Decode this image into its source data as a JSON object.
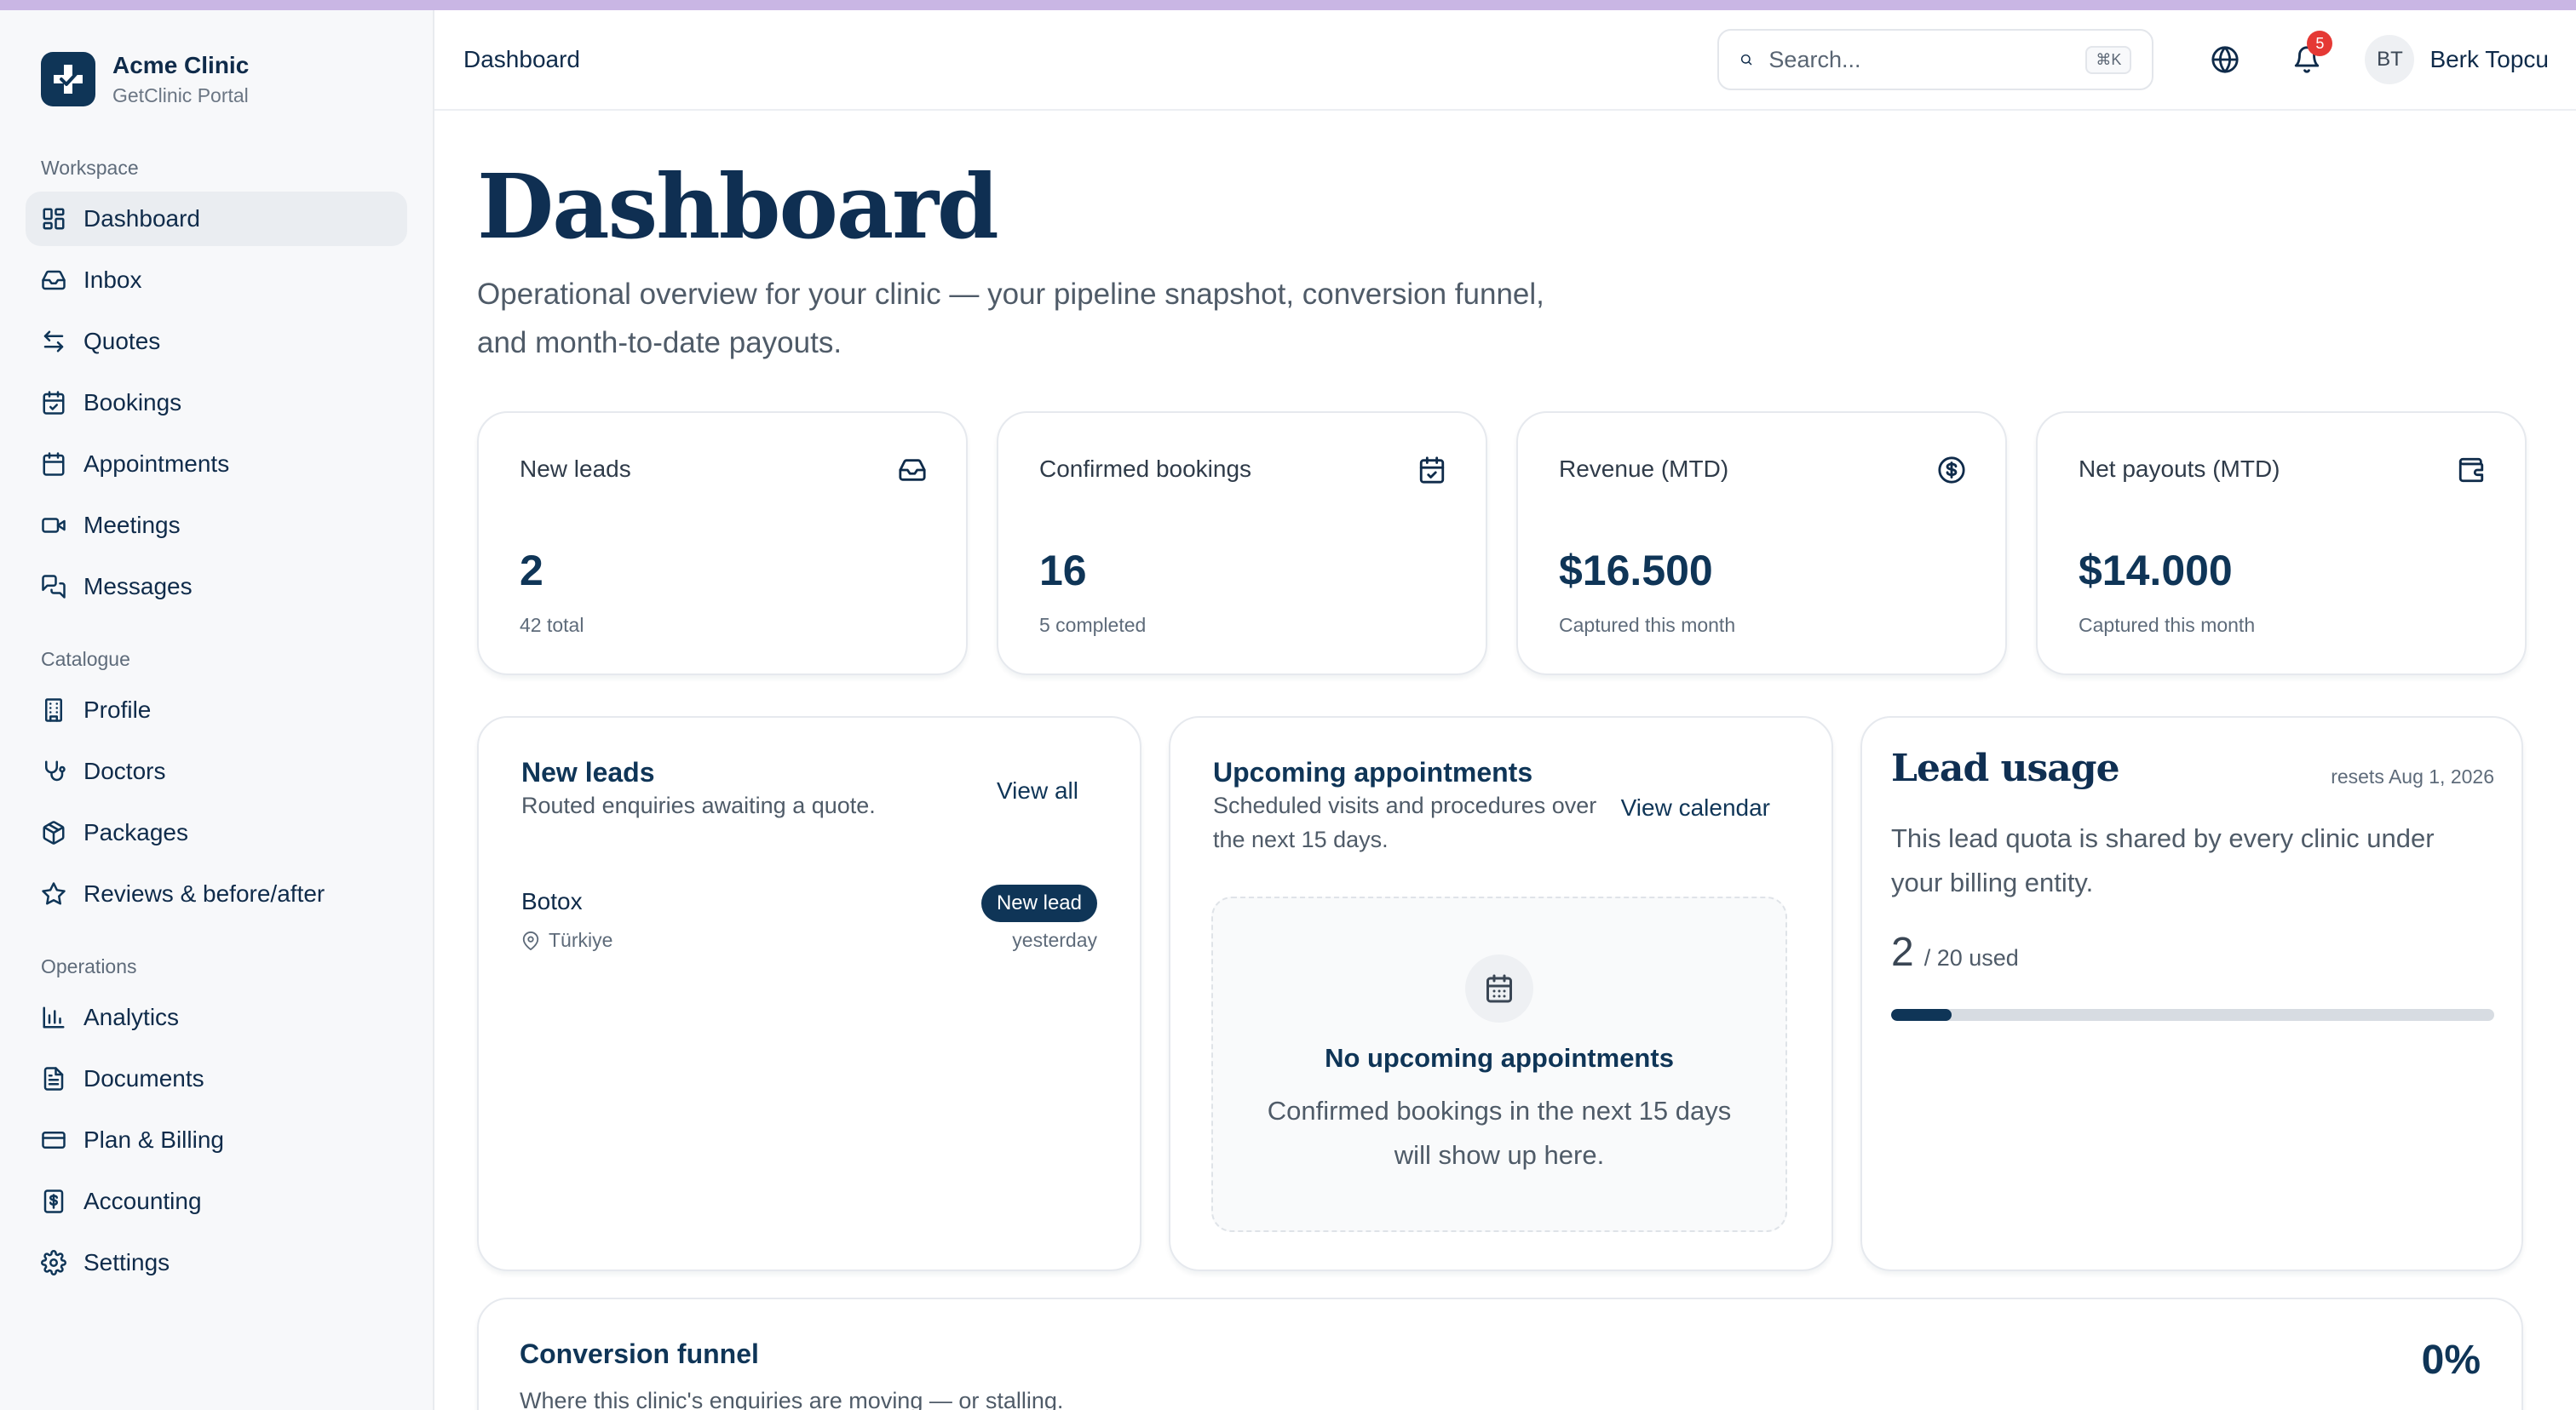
{
  "brand": {
    "name": "Acme Clinic",
    "subtitle": "GetClinic Portal"
  },
  "sidebar": {
    "sections": [
      {
        "label": "Workspace",
        "items": [
          {
            "label": "Dashboard",
            "icon": "dashboard-icon",
            "active": true
          },
          {
            "label": "Inbox",
            "icon": "inbox-icon"
          },
          {
            "label": "Quotes",
            "icon": "arrows-swap-icon"
          },
          {
            "label": "Bookings",
            "icon": "calendar-check-icon"
          },
          {
            "label": "Appointments",
            "icon": "calendar-icon"
          },
          {
            "label": "Meetings",
            "icon": "video-icon"
          },
          {
            "label": "Messages",
            "icon": "chat-icon"
          }
        ]
      },
      {
        "label": "Catalogue",
        "items": [
          {
            "label": "Profile",
            "icon": "building-icon"
          },
          {
            "label": "Doctors",
            "icon": "stethoscope-icon"
          },
          {
            "label": "Packages",
            "icon": "package-icon"
          },
          {
            "label": "Reviews & before/after",
            "icon": "star-icon"
          }
        ]
      },
      {
        "label": "Operations",
        "items": [
          {
            "label": "Analytics",
            "icon": "bar-chart-icon"
          },
          {
            "label": "Documents",
            "icon": "document-icon"
          },
          {
            "label": "Plan & Billing",
            "icon": "credit-card-icon"
          },
          {
            "label": "Accounting",
            "icon": "receipt-icon"
          },
          {
            "label": "Settings",
            "icon": "gear-icon"
          }
        ]
      }
    ]
  },
  "header": {
    "breadcrumb": "Dashboard",
    "search_placeholder": "Search...",
    "search_shortcut": "⌘K",
    "notification_count": "5",
    "user_initials": "BT",
    "user_name": "Berk Topcu"
  },
  "page": {
    "title": "Dashboard",
    "description": "Operational overview for your clinic — your pipeline snapshot, conversion funnel, and month-to-date payouts."
  },
  "stats": [
    {
      "label": "New leads",
      "value": "2",
      "sub": "42 total",
      "icon": "inbox-icon"
    },
    {
      "label": "Confirmed bookings",
      "value": "16",
      "sub": "5 completed",
      "icon": "calendar-check-icon"
    },
    {
      "label": "Revenue (MTD)",
      "value": "$16.500",
      "sub": "Captured this month",
      "icon": "dollar-circle-icon"
    },
    {
      "label": "Net payouts (MTD)",
      "value": "$14.000",
      "sub": "Captured this month",
      "icon": "wallet-icon"
    }
  ],
  "leads_card": {
    "title": "New leads",
    "subtitle": "Routed enquiries awaiting a quote.",
    "link": "View all",
    "items": [
      {
        "name": "Botox",
        "badge": "New lead",
        "location": "Türkiye",
        "time": "yesterday"
      }
    ]
  },
  "appointments_card": {
    "title": "Upcoming appointments",
    "subtitle": "Scheduled visits and procedures over the next 15 days.",
    "link": "View calendar",
    "empty_title": "No upcoming appointments",
    "empty_text": "Confirmed bookings in the next 15 days will show up here."
  },
  "usage_card": {
    "title": "Lead usage",
    "reset": "resets Aug 1, 2026",
    "description": "This lead quota is shared by every clinic under your billing entity.",
    "used": "2",
    "limit_text": "/ 20 used",
    "progress_fraction": 0.1
  },
  "funnel_card": {
    "title": "Conversion funnel",
    "subtitle": "Where this clinic's enquiries are moving — or stalling.",
    "percent": "0%"
  },
  "colors": {
    "primary": "#0f3557",
    "badge": "#e53935",
    "bar_track": "#d7dce2"
  }
}
